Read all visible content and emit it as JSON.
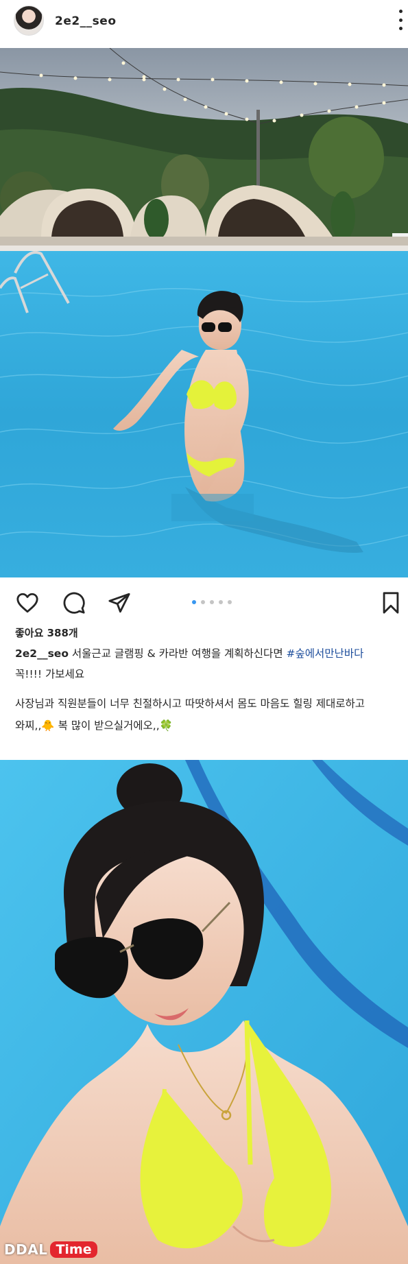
{
  "header": {
    "username": "2e2__seo",
    "avatar_icon": "profile-photo-avatar",
    "more_icon": "more-vertical-icon"
  },
  "post": {
    "carousel": {
      "total": 5,
      "active": 1
    },
    "actions": {
      "like_icon": "heart-outline-icon",
      "comment_icon": "comment-bubble-icon",
      "share_icon": "paper-plane-icon",
      "save_icon": "bookmark-outline-icon"
    },
    "likes_text": "좋아요 388개",
    "caption": {
      "user": "2e2__seo",
      "text": " 서울근교 글램핑 & 카라반 여행을 계획하신다면 ",
      "hashtag": "#숲에서만난바다",
      "line2": "꼭!!!! 가보세요"
    },
    "caption_body": {
      "line1": "사장님과 직원분들이 너무 친절하시고 따땃하셔서 몸도 마음도 힐링 제대로하고",
      "line2": "와찌,,🐥 복 많이 받으실거에오,,🍀"
    }
  },
  "watermark": {
    "brand_part1": "DDAL",
    "brand_part2": "Time"
  },
  "colors": {
    "hashtag": "#1e4e9c",
    "active_dot": "#3897f0",
    "inactive_dot": "#c4c4c4",
    "pool": "#38aede",
    "bikini": "#e4f23a",
    "watermark_red": "#e3262e"
  }
}
